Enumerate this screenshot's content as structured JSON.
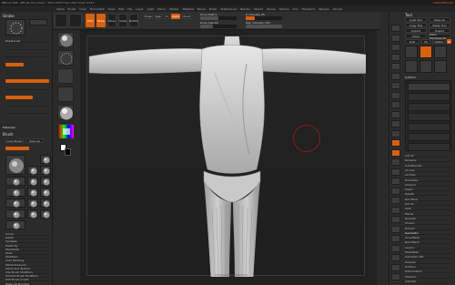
{
  "titlebar": {
    "left": "ZBrush 4R6  ·  ZBrush Document  ·  Mem 2975  Free 1763  Timer 0.017",
    "right": "DefaultZScript"
  },
  "menus": [
    "Alpha",
    "Brush",
    "Color",
    "Document",
    "Draw",
    "Edit",
    "File",
    "Layer",
    "Light",
    "Macro",
    "Marker",
    "Material",
    "Movie",
    "Picker",
    "Preferences",
    "Render",
    "Stencil",
    "Stroke",
    "Texture",
    "Tool",
    "Transform",
    "Zplugin",
    "Zscript"
  ],
  "toolbar": {
    "edit": "Edit",
    "draw": "Draw",
    "move": "Move",
    "scale": "Scale",
    "rotate": "Rotate",
    "mrgb": "Mrgb",
    "rgb": "Rgb",
    "m": "M",
    "zadd": "Zadd",
    "zsub": "Zsub",
    "focal_label": "Focal Shift 0",
    "draw_size_label": "Draw Size 64",
    "z_intensity_label": "Z Intensity 25",
    "rgb_intensity_label": "Rgb Intensity 100"
  },
  "left": {
    "stroke_title": "Stroke",
    "replaybutton": "ReplayLast",
    "brush_title": "Brush",
    "materials_title": "Materials",
    "load_brush": "Load Brush",
    "save_as": "Save As",
    "clone": "Clone",
    "lightbox": "Lightbox",
    "section_items": [
      "Curve",
      "Depth",
      "Samples",
      "Elasticity",
      "FiberMesh",
      "Twist",
      "Modifiers",
      "Auto Masking",
      "Tablet Pressure",
      "Alpha and Texture",
      "Clip Brush Modifiers",
      "Smooth Brush Modifiers",
      "Edit Brush Credit",
      "Reset All Brushes"
    ]
  },
  "right": {
    "tool_title": "Tool",
    "load_tool": "Load Tool",
    "save_as": "Save As",
    "copy_tool": "Copy Tool",
    "paste_tool": "Paste Tool",
    "import": "Import",
    "export": "Export",
    "clone": "Clone",
    "make_polymesh": "Make PolyMesh3D",
    "goz": "GoZ",
    "all": "All",
    "visible": "Visible",
    "r": "R",
    "subtool_title": "SubTool",
    "list_all": "List All",
    "rename": "Rename",
    "auto_reorder": "AutoReorder",
    "all_low": "All Low",
    "all_high": "All High",
    "duplicate": "Duplicate",
    "append": "Append",
    "insert": "Insert",
    "delete": "Delete",
    "del_other": "Del Other",
    "del_all": "Del All",
    "split": "Split",
    "merge": "Merge",
    "remesh": "Remesh",
    "project": "Project",
    "extract": "Extract",
    "geometry_title": "Geometry",
    "array_mesh": "ArrayMesh",
    "nano_mesh": "NanoMesh",
    "layers": "Layers",
    "fibermesh": "FiberMesh",
    "geometry_hd": "Geometry HD",
    "preview": "Preview",
    "surface": "Surface",
    "deformation": "Deformation",
    "masking": "Masking",
    "visibility": "Visibility",
    "polygroups": "Polygroups",
    "contact": "Contact"
  }
}
